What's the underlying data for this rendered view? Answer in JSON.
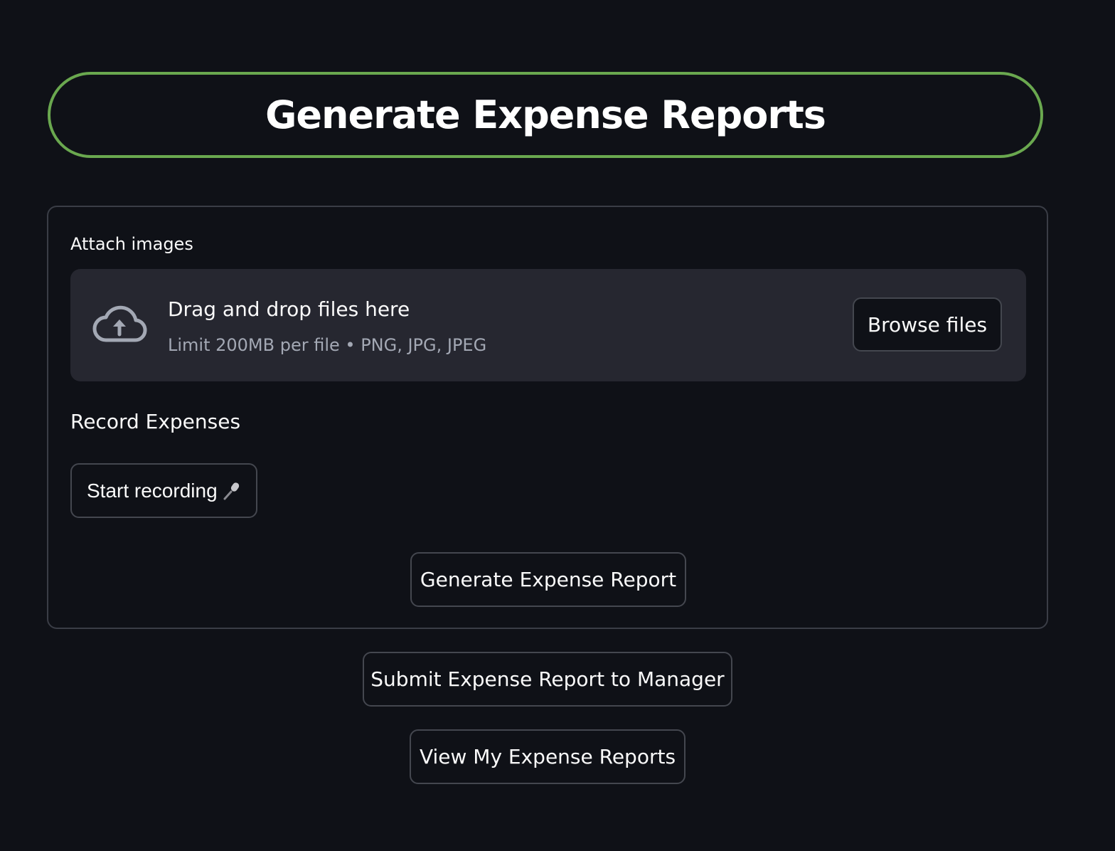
{
  "header": {
    "title": "Generate Expense Reports",
    "accent_color": "#6aa84f"
  },
  "uploader": {
    "label": "Attach images",
    "icon": "cloud-upload-icon",
    "dropzone_title": "Drag and drop files here",
    "dropzone_subtitle": "Limit 200MB per file • PNG, JPG, JPEG",
    "browse_label": "Browse files"
  },
  "recorder": {
    "label": "Record Expenses",
    "button_label": "Start recording",
    "button_icon": "microphone-icon"
  },
  "actions": {
    "generate_label": "Generate Expense Report",
    "submit_label": "Submit Expense Report to Manager",
    "view_label": "View My Expense Reports"
  },
  "colors": {
    "background": "#0f1117",
    "dropzone_bg": "#262730",
    "border": "#44474f"
  }
}
